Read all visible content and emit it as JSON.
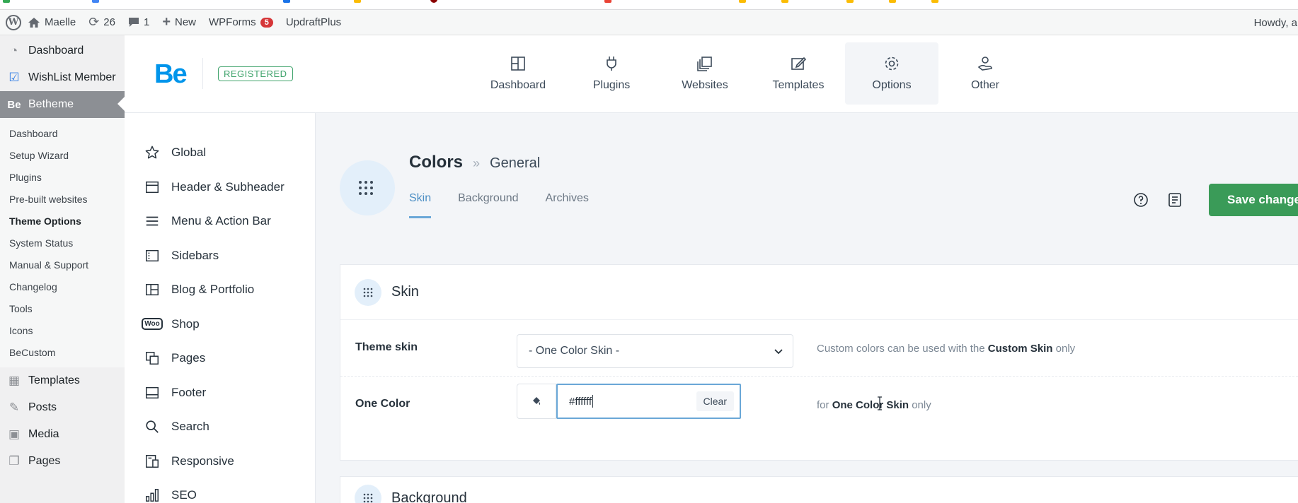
{
  "adminbar": {
    "site_name": "Maelle",
    "updates_count": "26",
    "comments_count": "1",
    "new_label": "New",
    "wpforms_label": "WPForms",
    "wpforms_badge": "5",
    "updraft_label": "UpdraftPlus",
    "howdy": "Howdy, a"
  },
  "wp_menu": {
    "dashboard": "Dashboard",
    "wishlist": "WishList Member",
    "betheme": "Betheme",
    "submenu": [
      "Dashboard",
      "Setup Wizard",
      "Plugins",
      "Pre-built websites",
      "Theme Options",
      "System Status",
      "Manual & Support",
      "Changelog",
      "Tools",
      "Icons",
      "BeCustom"
    ],
    "templates": "Templates",
    "posts": "Posts",
    "media": "Media",
    "pages": "Pages"
  },
  "be_header": {
    "logo": "Be",
    "registered": "REGISTERED",
    "nav": [
      "Dashboard",
      "Plugins",
      "Websites",
      "Templates",
      "Options",
      "Other"
    ],
    "active_nav": "Options"
  },
  "options_nav": [
    "Global",
    "Header & Subheader",
    "Menu & Action Bar",
    "Sidebars",
    "Blog & Portfolio",
    "Shop",
    "Pages",
    "Footer",
    "Search",
    "Responsive",
    "SEO"
  ],
  "woo_badge": "Woo",
  "page": {
    "title": "Colors",
    "separator": "»",
    "subtitle": "General",
    "tabs": [
      "Skin",
      "Background",
      "Archives"
    ],
    "active_tab": "Skin",
    "save_label": "Save changes"
  },
  "skin_section": {
    "title": "Skin",
    "theme_skin_label": "Theme skin",
    "theme_skin_value": "- One Color Skin -",
    "theme_skin_hint_pre": "Custom colors can be used with the ",
    "theme_skin_hint_bold": "Custom Skin",
    "theme_skin_hint_post": " only",
    "one_color_label": "One Color",
    "one_color_value": "#ffffff",
    "clear_label": "Clear",
    "one_color_hint_pre": "for ",
    "one_color_hint_bold": "One Color Skin",
    "one_color_hint_post": " only"
  },
  "background_section": {
    "title": "Background"
  },
  "colors": {
    "accent_blue": "#0095eb",
    "save_green": "#3a9b58",
    "registered_green": "#3fa36b",
    "tab_active": "#4b8ec4"
  }
}
